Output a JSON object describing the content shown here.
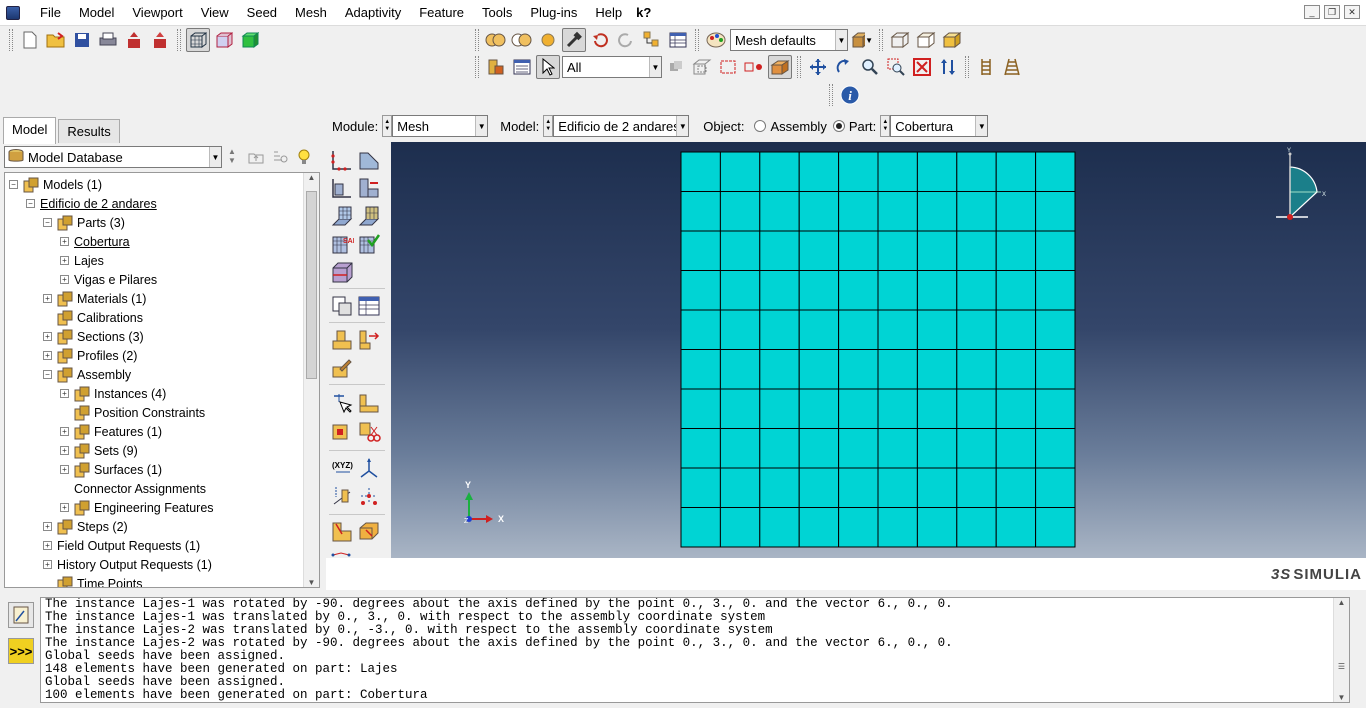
{
  "menu": {
    "items": [
      "File",
      "Model",
      "Viewport",
      "View",
      "Seed",
      "Mesh",
      "Adaptivity",
      "Feature",
      "Tools",
      "Plug-ins",
      "Help"
    ],
    "underline": [
      "F",
      "M",
      "p",
      "V",
      "S",
      "e",
      "A",
      "a",
      "T",
      "P",
      "H"
    ],
    "whats_this": "k?"
  },
  "toolbar": {
    "mesh_defaults": "Mesh defaults",
    "selection_filter": "All"
  },
  "context": {
    "module_label": "Module:",
    "module_value": "Mesh",
    "model_label": "Model:",
    "model_value": "Edificio de 2 andares",
    "object_label": "Object:",
    "assembly_label": "Assembly",
    "part_label": "Part:",
    "part_value": "Cobertura",
    "object_selected": "Part"
  },
  "left_panel": {
    "tabs": [
      "Model",
      "Results"
    ],
    "active_tab": "Model",
    "database": "Model Database",
    "tree": [
      {
        "label": "Models (1)",
        "level": 0,
        "expander": "-",
        "icon": "models-icon"
      },
      {
        "label": "Edificio de 2 andares",
        "level": 1,
        "expander": "-",
        "icon": "",
        "underline": true
      },
      {
        "label": "Parts (3)",
        "level": 2,
        "expander": "-",
        "icon": "parts-icon"
      },
      {
        "label": "Cobertura",
        "level": 3,
        "expander": "+",
        "icon": "",
        "underline": true
      },
      {
        "label": "Lajes",
        "level": 3,
        "expander": "+",
        "icon": ""
      },
      {
        "label": "Vigas e Pilares",
        "level": 3,
        "expander": "+",
        "icon": ""
      },
      {
        "label": "Materials (1)",
        "level": 2,
        "expander": "+",
        "icon": "materials-icon"
      },
      {
        "label": "Calibrations",
        "level": 2,
        "expander": "",
        "icon": "calibrations-icon"
      },
      {
        "label": "Sections (3)",
        "level": 2,
        "expander": "+",
        "icon": "sections-icon"
      },
      {
        "label": "Profiles (2)",
        "level": 2,
        "expander": "+",
        "icon": "profiles-icon"
      },
      {
        "label": "Assembly",
        "level": 2,
        "expander": "-",
        "icon": "assembly-icon"
      },
      {
        "label": "Instances (4)",
        "level": 3,
        "expander": "+",
        "icon": "instances-icon"
      },
      {
        "label": "Position Constraints",
        "level": 3,
        "expander": "",
        "icon": "constraints-icon"
      },
      {
        "label": "Features (1)",
        "level": 3,
        "expander": "+",
        "icon": "features-icon"
      },
      {
        "label": "Sets (9)",
        "level": 3,
        "expander": "+",
        "icon": "sets-icon"
      },
      {
        "label": "Surfaces (1)",
        "level": 3,
        "expander": "+",
        "icon": "surfaces-icon"
      },
      {
        "label": "Connector Assignments",
        "level": 3,
        "expander": "",
        "icon": ""
      },
      {
        "label": "Engineering Features",
        "level": 3,
        "expander": "+",
        "icon": "engineering-icon"
      },
      {
        "label": "Steps (2)",
        "level": 2,
        "expander": "+",
        "icon": "steps-icon"
      },
      {
        "label": "Field Output Requests (1)",
        "level": 2,
        "expander": "+",
        "icon": ""
      },
      {
        "label": "History Output Requests (1)",
        "level": 2,
        "expander": "+",
        "icon": ""
      },
      {
        "label": "Time Points",
        "level": 2,
        "expander": "",
        "icon": "time-points-icon"
      }
    ]
  },
  "viewport": {
    "mesh_rows": 10,
    "mesh_cols": 10,
    "mesh_color": "#00d4d4",
    "triad_labels": {
      "x": "X",
      "y": "Y",
      "z": "Z"
    },
    "small_triad_labels": {
      "x": "X",
      "y": "Y"
    },
    "brand": "SIMULIA"
  },
  "messages": [
    "The instance Lajes-1 was rotated by -90. degrees about the axis defined by the point 0., 3., 0. and the vector 6., 0., 0.",
    "The instance Lajes-1 was translated by 0., 3., 0. with respect to the assembly coordinate system",
    "The instance Lajes-2 was translated by 0., -3., 0. with respect to the assembly coordinate system",
    "The instance Lajes-2 was rotated by -90. degrees about the axis defined by the point 0., 3., 0. and the vector 6., 0., 0.",
    "Global seeds have been assigned.",
    "148 elements have been generated on part: Lajes",
    "Global seeds have been assigned.",
    "100 elements have been generated on part: Cobertura"
  ]
}
